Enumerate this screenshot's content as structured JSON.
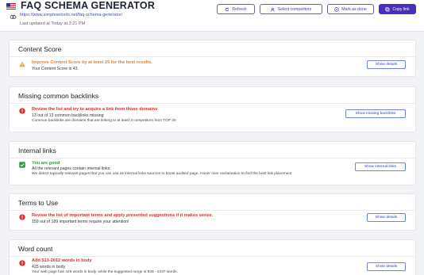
{
  "header": {
    "title": "FAQ SCHEMA GENERATOR",
    "url": "https://www.simplesetools.net/faq-schema-generator/",
    "updated": "Last updated at Today at 3:21 PM",
    "buttons": {
      "refresh": "Refresh",
      "select_competitors": "Select competitors",
      "mark_done": "Mark as done",
      "copy_link": "Copy link"
    }
  },
  "cards": {
    "content_score": {
      "title": "Content Score",
      "msg_title": "Improve Content Score by at least 25 for the best results.",
      "line1": "Your Content Score is 43.",
      "button": "Show details"
    },
    "backlinks": {
      "title": "Missing common backlinks",
      "msg_title": "Review the list and try to acquire a link from those domains",
      "line1": "13 out of 13 common backlinks missing",
      "line2": "Common backlinks are domains that are linking to at least 3 competitors from TOP 20",
      "button": "Show missing backlinks"
    },
    "internal_links": {
      "title": "Internal links",
      "msg_title": "You are good",
      "line1": "All the relevant pages contain internal links.",
      "line2": "We detect topically relevant pages that you can use as internal links sources to boost audited page. Hover over exclamation to find the best link placement.",
      "button": "Show internal links"
    },
    "terms": {
      "title": "Terms to Use",
      "msg_title": "Review the list of important terms and apply presented suggestions if it makes sense.",
      "line1": "159 out of 189 important terms require your attention!",
      "button": "Show details"
    },
    "word_count": {
      "title": "Word count",
      "msg_title": "Add 513-2012 words in body",
      "line1": "425 words in body",
      "line2": "Your web page has 425 words in body, while the suggested range is 938 - 2437 words.",
      "button": "Show details"
    }
  },
  "colors": {
    "warning": "#e5812b",
    "error": "#d92f2f",
    "success": "#2d9a45",
    "primary": "#4a2fb8"
  }
}
